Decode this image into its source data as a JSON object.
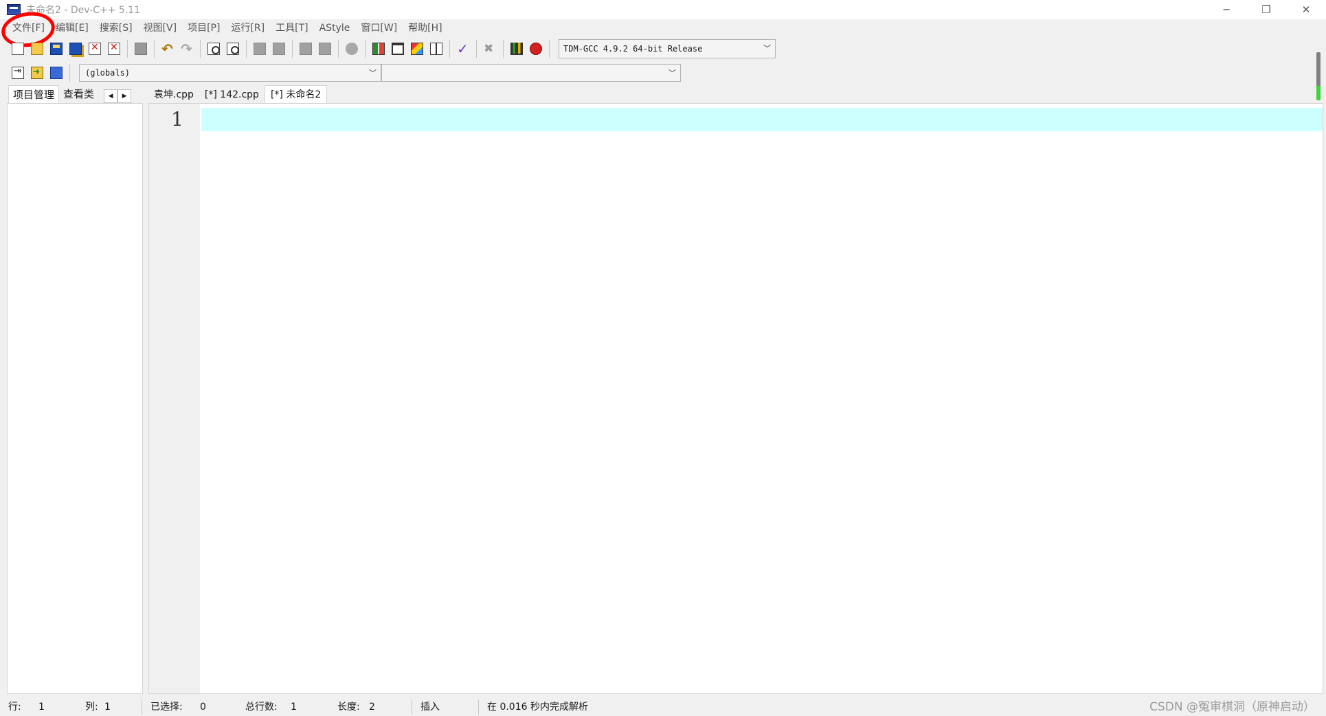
{
  "window": {
    "title": "未命名2 - Dev-C++ 5.11",
    "minimize_glyph": "─",
    "restore_glyph": "❐",
    "close_glyph": "✕"
  },
  "menu": {
    "items": [
      "文件[F]",
      "编辑[E]",
      "搜索[S]",
      "视图[V]",
      "项目[P]",
      "运行[R]",
      "工具[T]",
      "AStyle",
      "窗口[W]",
      "帮助[H]"
    ],
    "highlighted_item": "文件[F]",
    "highlight_color": "#ff0000"
  },
  "toolbar": {
    "compiler": "TDM-GCC 4.9.2 64-bit Release",
    "scope": "(globals)",
    "function": ""
  },
  "left_panel": {
    "tabs": [
      "项目管理",
      "查看类"
    ],
    "active_tab": "项目管理",
    "scroll_left": "◀",
    "scroll_right": "▶"
  },
  "editor": {
    "tabs": [
      "袁坤.cpp",
      "[*] 142.cpp",
      "[*] 未命名2"
    ],
    "active_tab": "[*] 未命名2",
    "line_numbers": [
      "1"
    ],
    "current_line_color": "#ccffff"
  },
  "status": {
    "row_label": "行:",
    "row_value": "1",
    "col_label": "列:",
    "col_value": "1",
    "selected_label": "已选择:",
    "selected_value": "0",
    "total_lines_label": "总行数:",
    "total_lines_value": "1",
    "length_label": "长度:",
    "length_value": "2",
    "insert_mode": "插入",
    "parse_message": "在 0.016 秒内完成解析"
  },
  "watermark": "CSDN @冤审棋洞（原神启动）"
}
